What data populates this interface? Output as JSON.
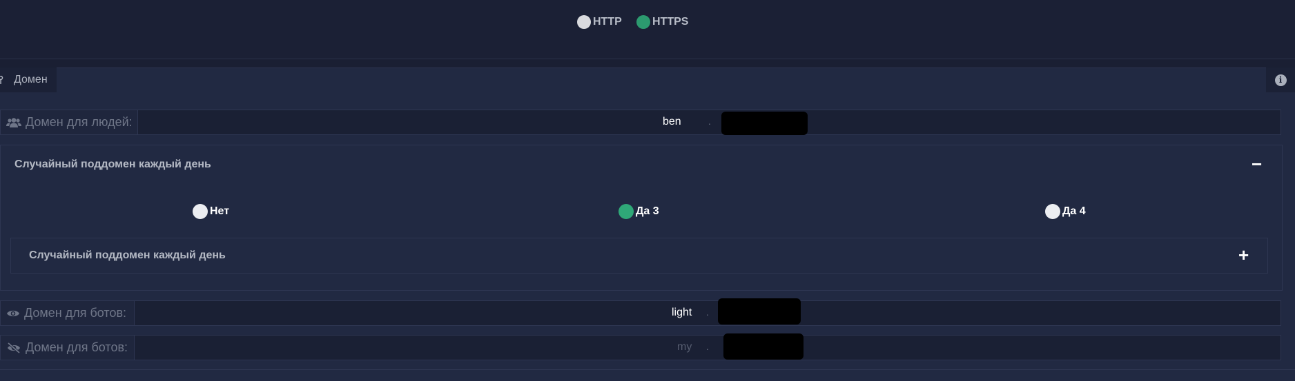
{
  "protocol": {
    "options": [
      {
        "label": "HTTP",
        "selected": false
      },
      {
        "label": "HTTPS",
        "selected": true
      }
    ]
  },
  "panel": {
    "tab_label": "Домен",
    "info_icon": "info-icon"
  },
  "fields": {
    "people": {
      "label": "Домен для людей:",
      "subdomain": "ben",
      "separator": ".",
      "icon": "users-icon"
    },
    "bots_visible": {
      "label": "Домен для ботов:",
      "subdomain": "light",
      "separator": ".",
      "icon": "eye-icon"
    },
    "bots_hidden": {
      "label": "Домен для ботов:",
      "subdomain_placeholder": "my",
      "separator": ".",
      "icon": "eye-slash-icon"
    }
  },
  "random_subdomain": {
    "title": "Случайный поддомен каждый день",
    "toggle": "−",
    "options": [
      {
        "label": "Нет",
        "selected": false
      },
      {
        "label": "Да 3",
        "selected": true
      },
      {
        "label": "Да 4",
        "selected": false
      }
    ],
    "inner": {
      "title": "Случайный поддомен каждый день",
      "toggle": "+"
    }
  },
  "colors": {
    "accent_green": "#2fa878",
    "background": "#1a1f33",
    "panel": "#212942"
  }
}
